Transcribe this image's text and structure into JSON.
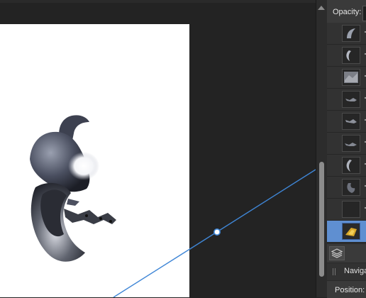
{
  "panel": {
    "opacity_label": "Opacity:",
    "navigator_label": "Naviga",
    "position_label": "Position:"
  },
  "layers": [
    {
      "thumb": "dark-curve-shape",
      "selected": false
    },
    {
      "thumb": "crescent-shape",
      "selected": false
    },
    {
      "thumb": "gray-texture",
      "selected": false
    },
    {
      "thumb": "wire-pieces",
      "selected": false
    },
    {
      "thumb": "wire-pieces",
      "selected": false
    },
    {
      "thumb": "wire-pieces",
      "selected": false
    },
    {
      "thumb": "crescent-shape",
      "selected": false
    },
    {
      "thumb": "dark-curve-shape",
      "selected": false
    },
    {
      "thumb": "empty",
      "selected": false
    },
    {
      "thumb": "gold-object",
      "selected": true
    }
  ],
  "colors": {
    "accent": "#5f8fd1",
    "guide_line": "#3f86d6",
    "canvas_bg": "#232323",
    "panel_bg": "#3a3a3a"
  },
  "icons": {
    "layers_button": "layers-stack-icon",
    "scroll_up": "scroll-up-arrow-icon",
    "drag_handle": "grip-icon"
  }
}
